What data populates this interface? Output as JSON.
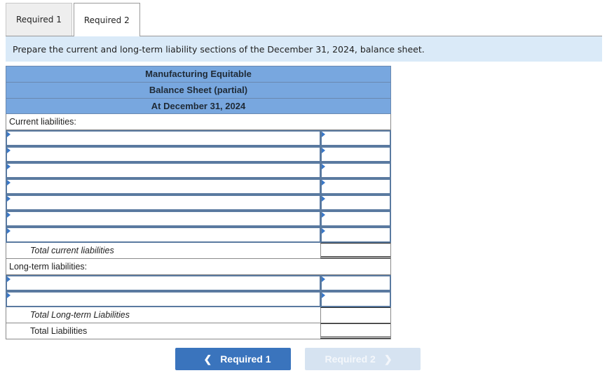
{
  "tabs": [
    {
      "label": "Required 1",
      "active": false
    },
    {
      "label": "Required 2",
      "active": true
    }
  ],
  "instruction": "Prepare the current and long-term liability sections of the December 31, 2024, balance sheet.",
  "sheet": {
    "header": {
      "company": "Manufacturing Equitable",
      "title": "Balance Sheet (partial)",
      "date": "At December 31, 2024"
    },
    "current_section_label": "Current liabilities:",
    "current_rows": [
      {
        "description": "",
        "amount": ""
      },
      {
        "description": "",
        "amount": ""
      },
      {
        "description": "",
        "amount": ""
      },
      {
        "description": "",
        "amount": ""
      },
      {
        "description": "",
        "amount": ""
      },
      {
        "description": "",
        "amount": ""
      },
      {
        "description": "",
        "amount": ""
      }
    ],
    "total_current_label": "Total current liabilities",
    "total_current_value": "",
    "longterm_section_label": "Long-term liabilities:",
    "longterm_rows": [
      {
        "description": "",
        "amount": ""
      },
      {
        "description": "",
        "amount": ""
      }
    ],
    "total_longterm_label": "Total Long-term Liabilities",
    "total_longterm_value": "",
    "total_liabilities_label": "Total Liabilities",
    "total_liabilities_value": ""
  },
  "nav": {
    "prev_label": "Required 1",
    "next_label": "Required 2",
    "prev_icon": "chevron-left-icon",
    "next_icon": "chevron-right-icon"
  }
}
